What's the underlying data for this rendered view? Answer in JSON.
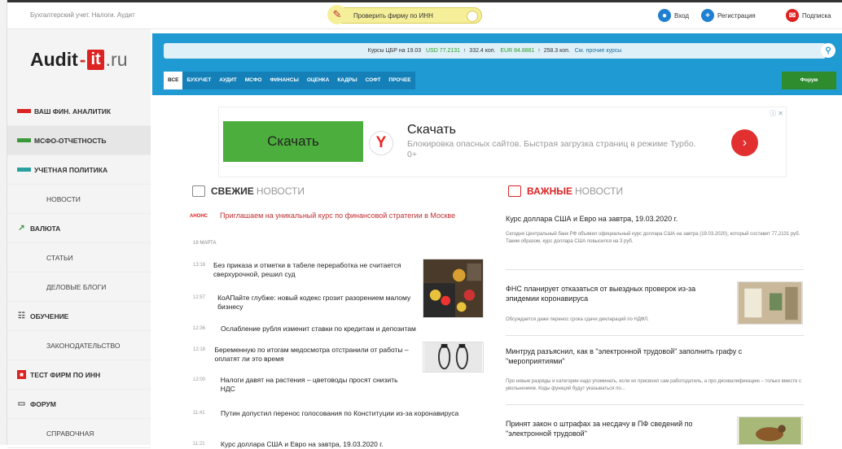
{
  "topbar": {
    "tagline": "Бухгалтерский учет. Налоги. Аудит",
    "check_label": "Проверить фирму по ИНН",
    "login_label": "Вход",
    "register_label": "Регистрация",
    "subscribe_label": "Подписка"
  },
  "logo": {
    "part1": "Audit",
    "dash": "-",
    "part2": "it",
    "part3": ".ru"
  },
  "sidebar": {
    "items": [
      {
        "label": "Ваш фин. аналитик",
        "icon": "red-flag"
      },
      {
        "label": "МСФО-отчетность",
        "icon": "green-flag"
      },
      {
        "label": "Учетная политика",
        "icon": "teal-flag"
      },
      {
        "label": "Новости"
      },
      {
        "label": "Валюта",
        "icon": "chart-icon"
      },
      {
        "label": "Статьи"
      },
      {
        "label": "Деловые блоги"
      },
      {
        "label": "Обучение",
        "icon": "book-icon"
      },
      {
        "label": "Законодательство"
      },
      {
        "label": "Тест фирм по ИНН",
        "icon": "red-square-icon"
      },
      {
        "label": "Форум",
        "icon": "chat-icon"
      },
      {
        "label": "Справочная"
      }
    ]
  },
  "rates": {
    "prefix": "Курсы ЦБР на 19.03",
    "usd": "USD 77.2131",
    "sep1": "↑",
    "usd_rub": "332.4 коп.",
    "eur": "EUR 84.8881",
    "sep2": "↑",
    "eur_rub": "258.3 коп.",
    "more": "См. прочие курсы"
  },
  "nav": {
    "tabs": [
      "Все",
      "Бухучет",
      "Аудит",
      "МСФО",
      "Финансы",
      "Оценка",
      "Кадры",
      "Софт",
      "Прочее"
    ],
    "forum_label": "Форум"
  },
  "ad": {
    "button_label": "Скачать",
    "y_letter": "Y",
    "title": "Скачать",
    "text": "Блокировка опасных сайтов. Быстрая загрузка страниц в режиме Турбо. 0+",
    "go_glyph": "›",
    "close_glyph": "ⓘ ✕"
  },
  "fresh": {
    "title_bold": "Свежие",
    "title_rest": "новости",
    "anons_tag": "АНОНС",
    "anons_text": "Приглашаем на уникальный курс по финансовой стратегии в Москве",
    "date": "19 марта",
    "items": [
      {
        "time": "13:18",
        "headline": "Без приказа и отметки в табеле переработка не считается сверхурочной, решил суд"
      },
      {
        "time": "12:57",
        "headline": "КоАПайте глубже: новый кодекс грозит разорением малому бизнесу"
      },
      {
        "time": "12:36",
        "headline": "Ослабление рубля изменит ставки по кредитам и депозитам"
      },
      {
        "time": "12:18",
        "headline": "Беременную по итогам медосмотра отстранили от работы – оплатят ли это время"
      },
      {
        "time": "12:00",
        "headline": "Налоги давят на растения – цветоводы просят снизить НДС"
      },
      {
        "time": "11:41",
        "headline": "Путин допустил перенос голосования по Конституции из-за коронавируса"
      },
      {
        "time": "11:21",
        "headline": "Курс доллара США и Евро на завтра, 19.03.2020 г."
      }
    ]
  },
  "important": {
    "title_bold": "Важные",
    "title_rest": "новости",
    "items": [
      {
        "headline": "Курс доллара США и Евро на завтра, 19.03.2020 г.",
        "text": "Сегодня Центральный банк РФ объявил официальный курс доллара США на завтра (19.03.2020), который составит 77,2131 руб. Таким образом, курс доллара США повысился на 3 руб."
      },
      {
        "headline": "ФНС планирует отказаться от выездных проверок из-за эпидемии коронавируса",
        "text": "Обсуждается даже перенос срока сдачи деклараций по НДФЛ."
      },
      {
        "headline": "Минтруд разъяснил, как в \"электронной трудовой\" заполнить графу с \"мероприятиями\"",
        "text": "Про новые разряды и категории надо упоминать, если их присвоил сам работодатель, а про дисквалификацию – только вместе с увольнением. Коды функций будут указываться по..."
      },
      {
        "headline": "Принят закон о штрафах за несдачу в ПФ сведений по \"электронной трудовой\"",
        "text": ""
      }
    ]
  },
  "colors": {
    "brand_blue": "#1f9ad2",
    "brand_red": "#d22",
    "forum_green": "#2e8b2e"
  }
}
